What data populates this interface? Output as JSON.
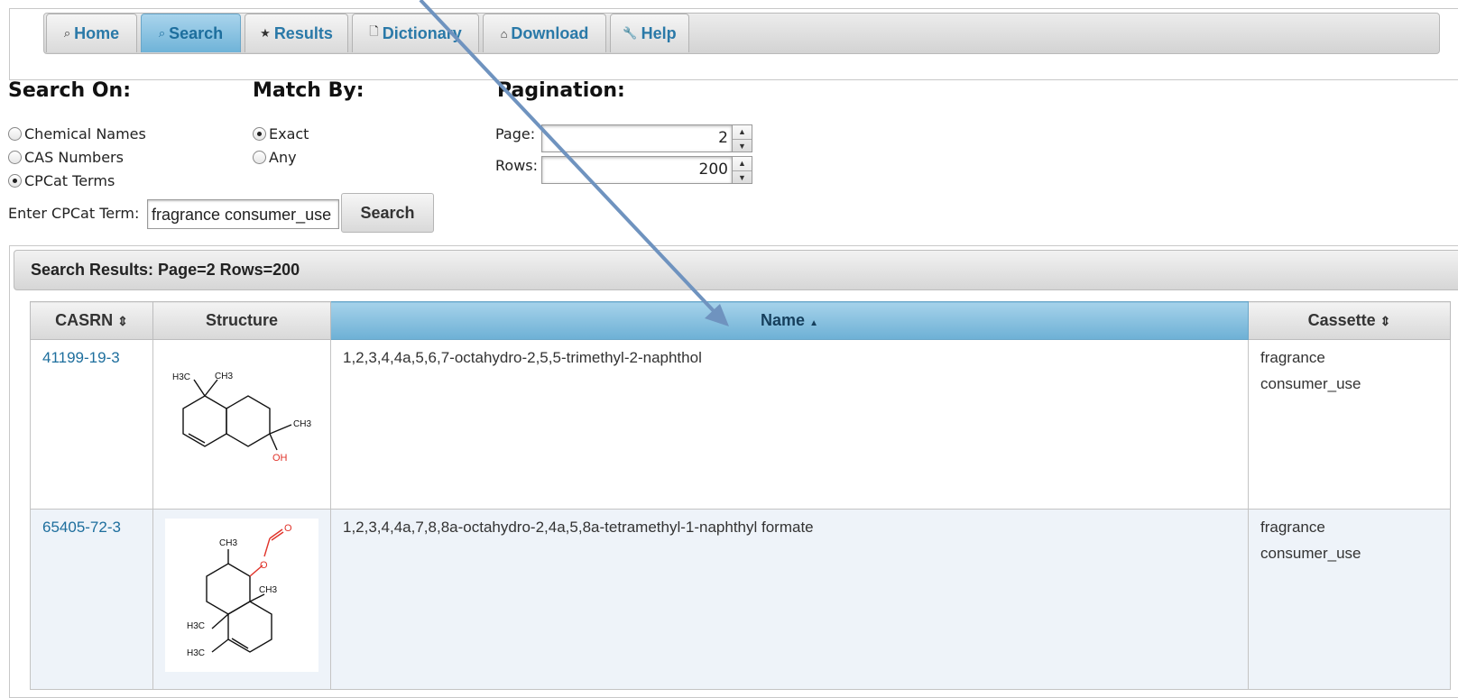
{
  "nav": {
    "tabs": [
      {
        "label": "Home",
        "icon": "search-icon",
        "glyph": "⌕"
      },
      {
        "label": "Search",
        "icon": "search-icon",
        "glyph": "⌕"
      },
      {
        "label": "Results",
        "icon": "star-icon",
        "glyph": "★"
      },
      {
        "label": "Dictionary",
        "icon": "document-icon",
        "glyph": "🗋"
      },
      {
        "label": "Download",
        "icon": "home-icon",
        "glyph": "⌂"
      },
      {
        "label": "Help",
        "icon": "wrench-icon",
        "glyph": "🔧"
      }
    ],
    "active_tab": "Search"
  },
  "search_on": {
    "heading": "Search On:",
    "options": [
      "Chemical Names",
      "CAS Numbers",
      "CPCat Terms"
    ],
    "selected": "CPCat Terms"
  },
  "match_by": {
    "heading": "Match By:",
    "options": [
      "Exact",
      "Any"
    ],
    "selected": "Exact"
  },
  "pagination": {
    "heading": "Pagination:",
    "page_label": "Page:",
    "page_value": "2",
    "rows_label": "Rows:",
    "rows_value": "200"
  },
  "term": {
    "label": "Enter CPCat Term:",
    "value": "fragrance consumer_use",
    "button": "Search"
  },
  "results": {
    "title": "Search Results: Page=2 Rows=200",
    "columns": [
      {
        "label": "CASRN",
        "sort": "⇕"
      },
      {
        "label": "Structure",
        "sort": ""
      },
      {
        "label": "Name",
        "sort": "▲"
      },
      {
        "label": "Cassette",
        "sort": "⇕"
      }
    ],
    "rows": [
      {
        "casrn": "41199-19-3",
        "name": "1,2,3,4,4a,5,6,7-octahydro-2,5,5-trimethyl-2-naphthol",
        "cassette": [
          "fragrance",
          "consumer_use"
        ],
        "structure_labels": [
          "H3C",
          "CH3",
          "CH3",
          "OH"
        ]
      },
      {
        "casrn": "65405-72-3",
        "name": "1,2,3,4,4a,7,8,8a-octahydro-2,4a,5,8a-tetramethyl-1-naphthyl formate",
        "cassette": [
          "fragrance",
          "consumer_use"
        ],
        "structure_labels": [
          "CH3",
          "O",
          "O",
          "CH3",
          "H3C",
          "H3C"
        ]
      }
    ]
  },
  "colors": {
    "accent": "#2a79a8",
    "active_tab": "#7dbde0",
    "arrow": "#6f93bf"
  }
}
